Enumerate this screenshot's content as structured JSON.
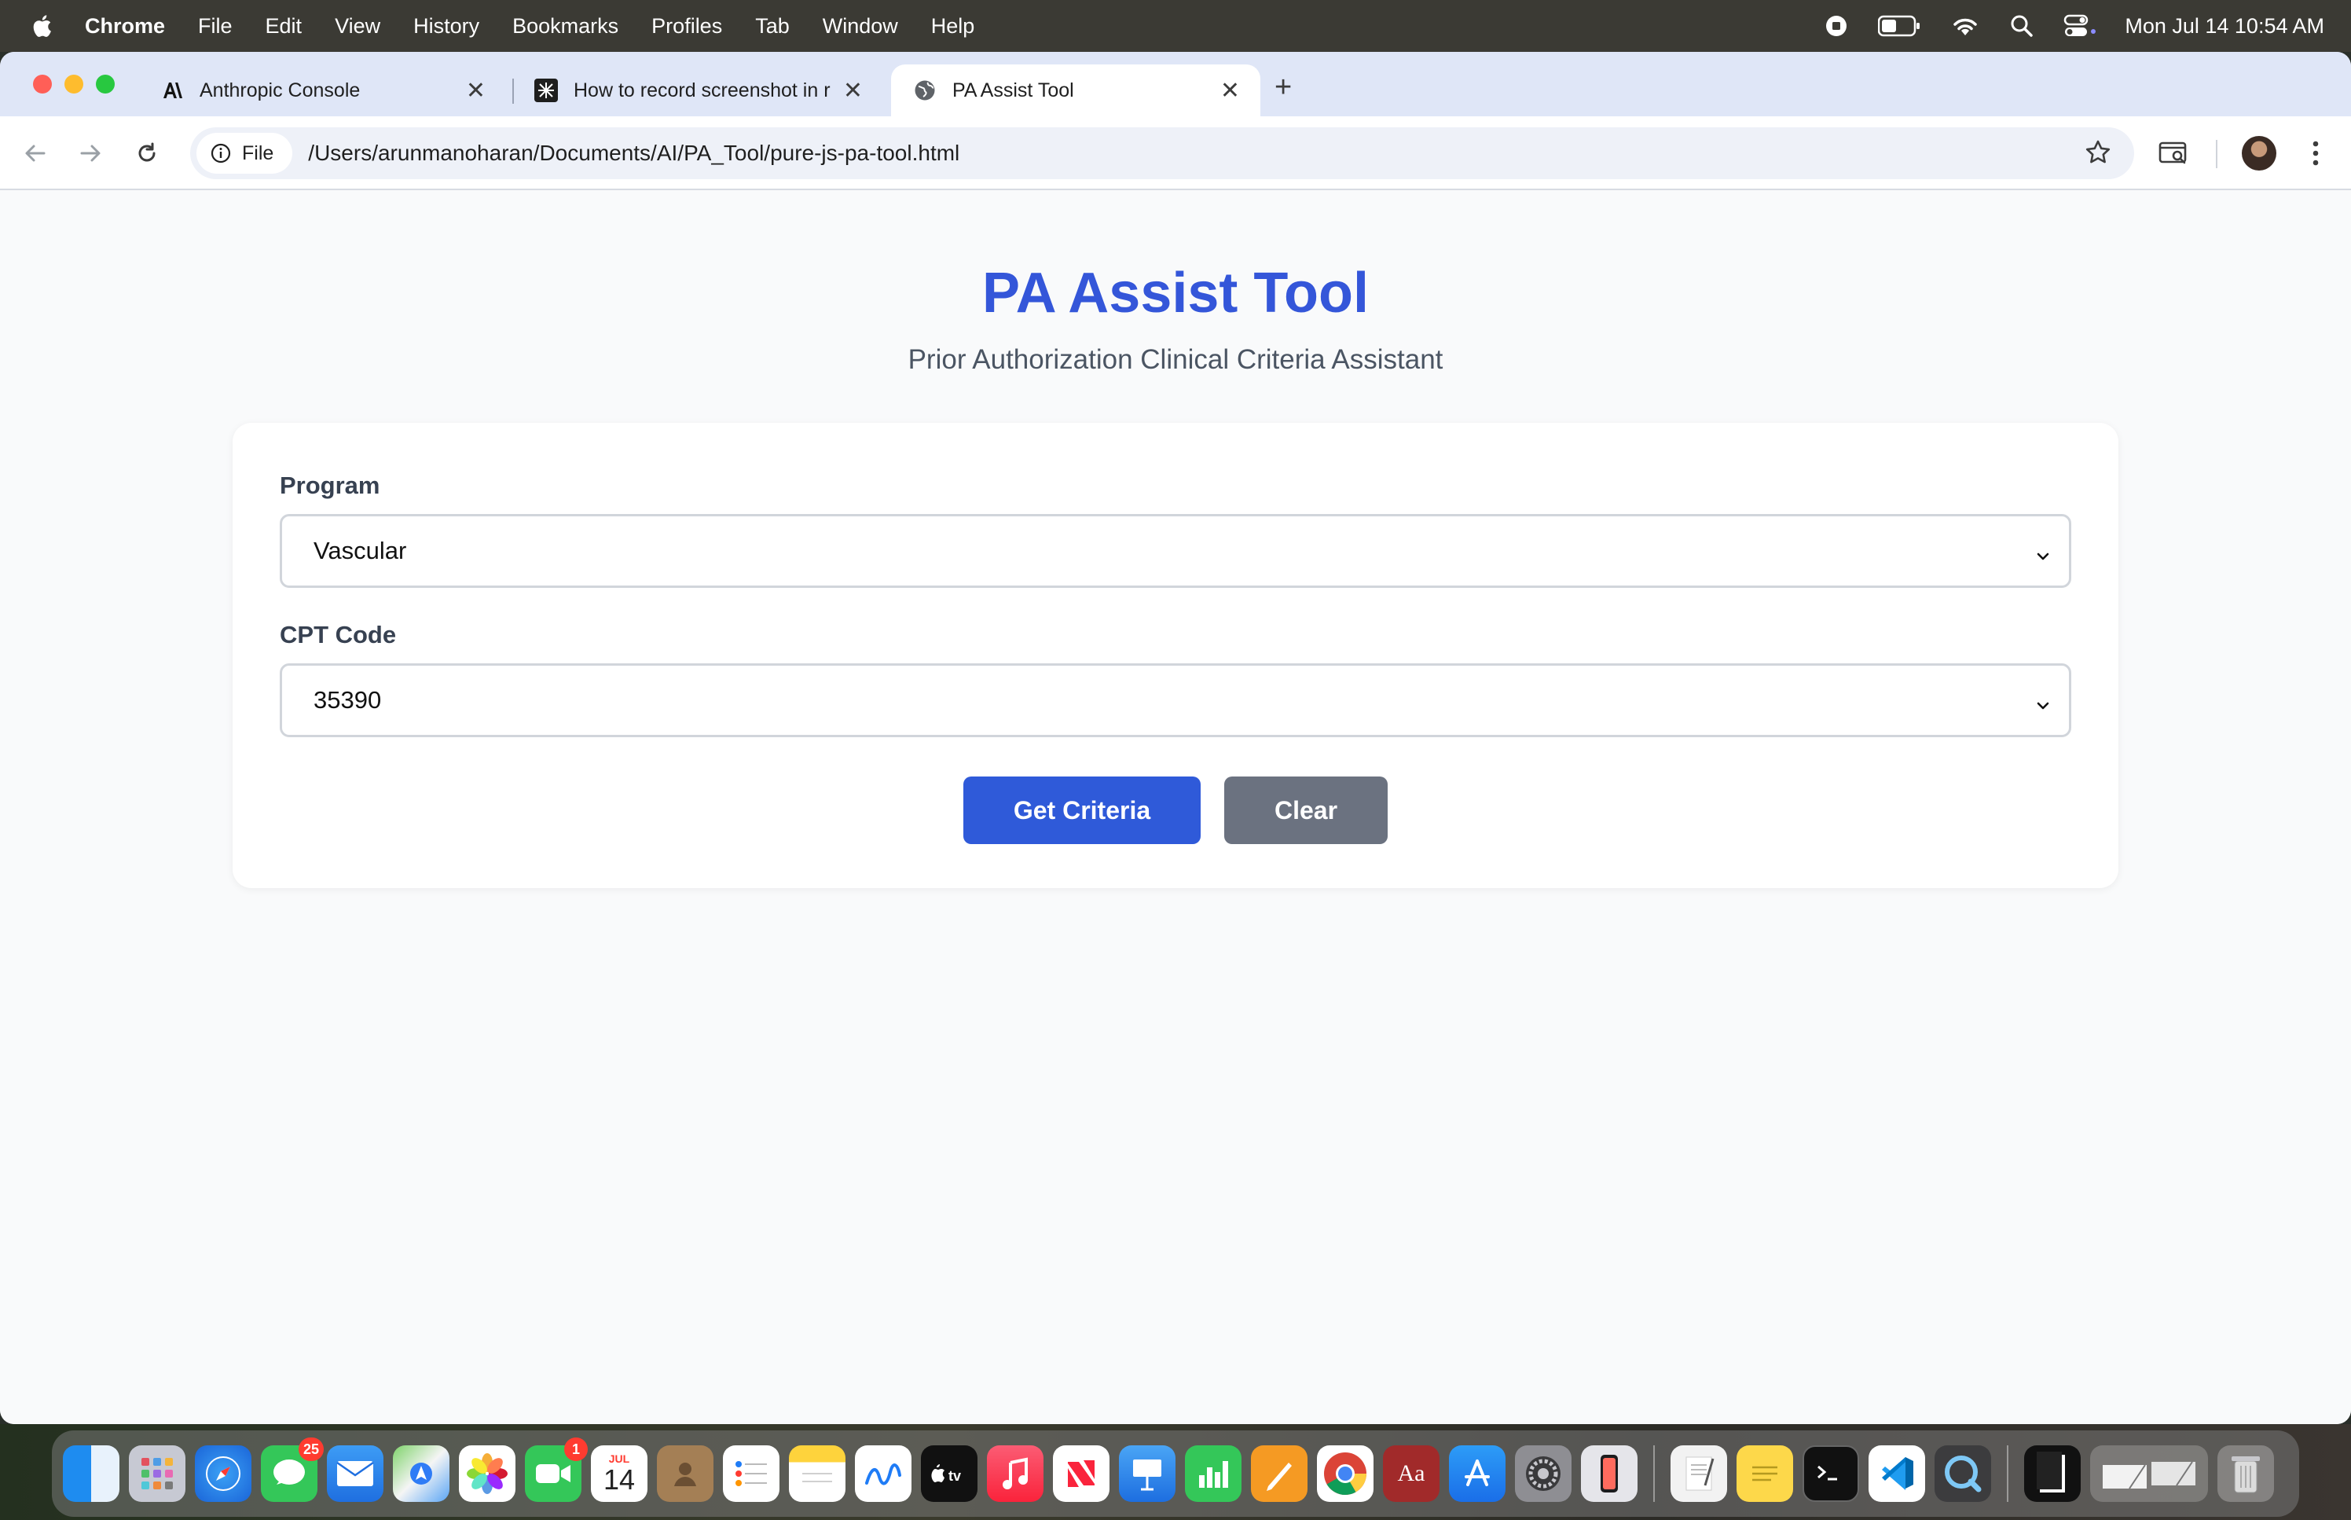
{
  "menubar": {
    "app_name": "Chrome",
    "items": [
      "File",
      "Edit",
      "View",
      "History",
      "Bookmarks",
      "Profiles",
      "Tab",
      "Window",
      "Help"
    ],
    "clock": "Mon Jul 14  10:54 AM"
  },
  "browser": {
    "tabs": [
      {
        "title": "Anthropic Console",
        "icon": "anthropic-icon"
      },
      {
        "title": "How to record screenshot in r",
        "icon": "site-icon"
      },
      {
        "title": "PA Assist Tool",
        "icon": "globe-icon",
        "active": true
      }
    ],
    "address": {
      "chip_label": "File",
      "url": "/Users/arunmanoharan/Documents/AI/PA_Tool/pure-js-pa-tool.html"
    }
  },
  "page": {
    "title": "PA Assist Tool",
    "subtitle": "Prior Authorization Clinical Criteria Assistant",
    "form": {
      "program_label": "Program",
      "program_value": "Vascular",
      "cpt_label": "CPT Code",
      "cpt_value": "35390",
      "get_criteria_label": "Get Criteria",
      "clear_label": "Clear"
    }
  },
  "dock": {
    "messages_badge": "25",
    "facetime_badge": "1",
    "calendar_month": "JUL",
    "calendar_day": "14",
    "dictionary_label": "Aa"
  },
  "colors": {
    "title_blue": "#3456d9",
    "primary_button": "#2f5ad9",
    "secondary_button": "#6b7280"
  }
}
